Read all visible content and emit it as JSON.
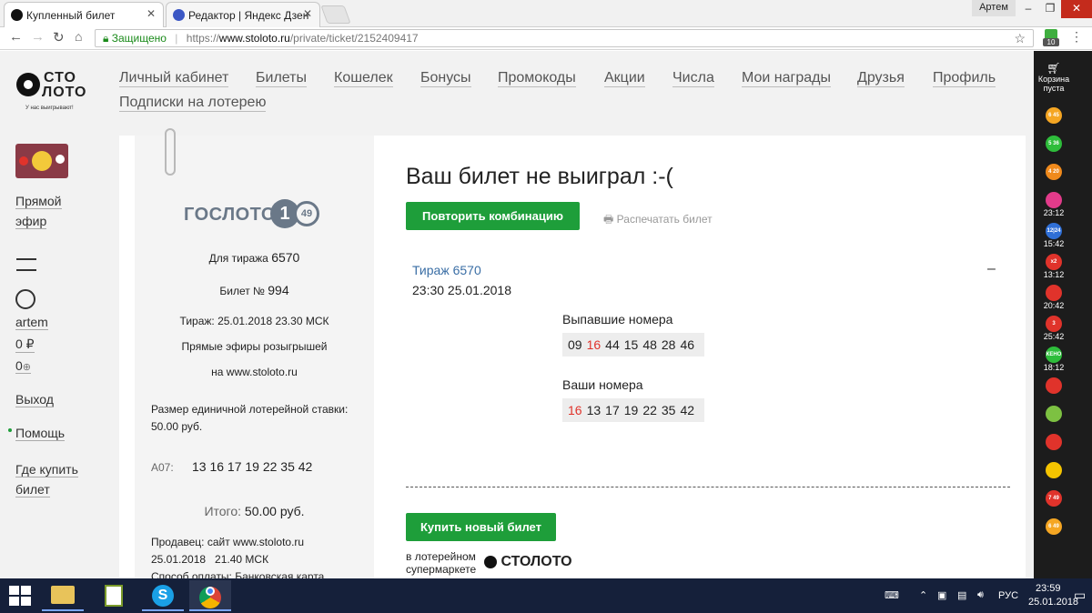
{
  "browser": {
    "tabs": [
      {
        "title": "Купленный билет",
        "active": true
      },
      {
        "title": "Редактор | Яндекс Дзен",
        "active": false
      }
    ],
    "profile_name": "Артем",
    "secure_label": "Защищено",
    "url_scheme": "https://",
    "url_host": "www.stoloto.ru",
    "url_path": "/private/ticket/2152409417",
    "extension_badge": "10"
  },
  "site": {
    "logo_top": "СТО",
    "logo_bottom": "ЛОТО",
    "logo_tagline": "У нас выигрывают!",
    "nav": [
      "Личный кабинет",
      "Билеты",
      "Кошелек",
      "Бонусы",
      "Промокоды",
      "Акции",
      "Числа",
      "Мои награды",
      "Друзья",
      "Профиль",
      "Подписки на лотерею"
    ],
    "sidebar": {
      "live_label_1": "Прямой",
      "live_label_2": "эфир",
      "username": "artem",
      "balance": "0 ₽",
      "bonus": "0",
      "logout": "Выход",
      "help": "Помощь",
      "where_buy_1": "Где купить",
      "where_buy_2": "билет"
    }
  },
  "ticket": {
    "brand": "ГОСЛОТО",
    "badge_big": "1",
    "badge_small": "49",
    "draw_label": "Для тиража",
    "draw_number": "6570",
    "ticket_label": "Билет №",
    "ticket_number": "994",
    "draw_date": "Тираж: 25.01.2018 23.30 МСК",
    "live_1": "Прямые эфиры розыгрышей",
    "live_2": "на www.stoloto.ru",
    "stake_1": "Размер единичной лотерейной ставки:",
    "stake_2": "50.00 руб.",
    "combo_label": "A07:",
    "combo": "13 16 17 19 22 35 42",
    "total_label": "Итого:",
    "total_value": "50.00 руб.",
    "seller": "Продавец: сайт www.stoloto.ru",
    "seller_date": "25.01.2018   21.40 МСК",
    "payment": "Способ оплаты: Банковская карта"
  },
  "result": {
    "title": "Ваш билет не выиграл :-(",
    "repeat_button": "Повторить комбинацию",
    "print_button": "Распечатать билет",
    "draw_link": "Тираж 6570",
    "draw_datetime": "23:30 25.01.2018",
    "collapse": "–",
    "drawn_label": "Выпавшие номера",
    "drawn_numbers": [
      {
        "n": "09",
        "hit": false
      },
      {
        "n": "16",
        "hit": true
      },
      {
        "n": "44",
        "hit": false
      },
      {
        "n": "15",
        "hit": false
      },
      {
        "n": "48",
        "hit": false
      },
      {
        "n": "28",
        "hit": false
      },
      {
        "n": "46",
        "hit": false
      }
    ],
    "your_label": "Ваши номера",
    "your_numbers": [
      {
        "n": "16",
        "hit": true
      },
      {
        "n": "13",
        "hit": false
      },
      {
        "n": "17",
        "hit": false
      },
      {
        "n": "19",
        "hit": false
      },
      {
        "n": "22",
        "hit": false
      },
      {
        "n": "35",
        "hit": false
      },
      {
        "n": "42",
        "hit": false
      }
    ],
    "buy_button": "Купить новый билет",
    "market_1": "в лотерейном",
    "market_2": "супермаркете",
    "market_brand": "СТОЛОТО"
  },
  "extbar": {
    "cart_1": "Корзина",
    "cart_2": "пуста",
    "games": [
      {
        "icon": "lotto-6-45-icon",
        "color": "#f5a623",
        "text": "6 45",
        "time": ""
      },
      {
        "icon": "lotto-5-36-icon",
        "color": "#2ebd3b",
        "text": "5 36",
        "time": ""
      },
      {
        "icon": "lotto-4-20-icon",
        "color": "#f08a1c",
        "text": "4 20",
        "time": ""
      },
      {
        "icon": "rapido-icon",
        "color": "#e23b8a",
        "text": "",
        "time": "23:12"
      },
      {
        "icon": "12-24-icon",
        "color": "#2f6fd6",
        "text": "12|24",
        "time": "15:42"
      },
      {
        "icon": "x2-icon",
        "color": "#e0332b",
        "text": "x2",
        "time": "13:12"
      },
      {
        "icon": "top3-icon",
        "color": "#e0332b",
        "text": "",
        "time": "20:42"
      },
      {
        "icon": "top3-3-icon",
        "color": "#e0332b",
        "text": "3",
        "time": "25:42"
      },
      {
        "icon": "keno-icon",
        "color": "#2ebd3b",
        "text": "КЕНО",
        "time": "18:12"
      },
      {
        "icon": "housing-lottery-icon",
        "color": "#e0332b",
        "text": "",
        "time": ""
      },
      {
        "icon": "bingo-icon",
        "color": "#7dc142",
        "text": "",
        "time": ""
      },
      {
        "icon": "russian-lotto-icon",
        "color": "#e0332b",
        "text": "",
        "time": ""
      },
      {
        "icon": "horseshoe-icon",
        "color": "#f5c400",
        "text": "",
        "time": ""
      },
      {
        "icon": "gosloto-7-49-icon",
        "color": "#e0332b",
        "text": "7 49",
        "time": ""
      },
      {
        "icon": "sportloto-6-49-icon",
        "color": "#f5a623",
        "text": "6 49",
        "time": ""
      }
    ]
  },
  "taskbar": {
    "lang": "РУС",
    "time": "23:59",
    "date": "25.01.2018"
  },
  "colors": {
    "brand_green": "#1e9e3a",
    "hit_red": "#e0332b",
    "link_blue": "#3a6ea5"
  }
}
